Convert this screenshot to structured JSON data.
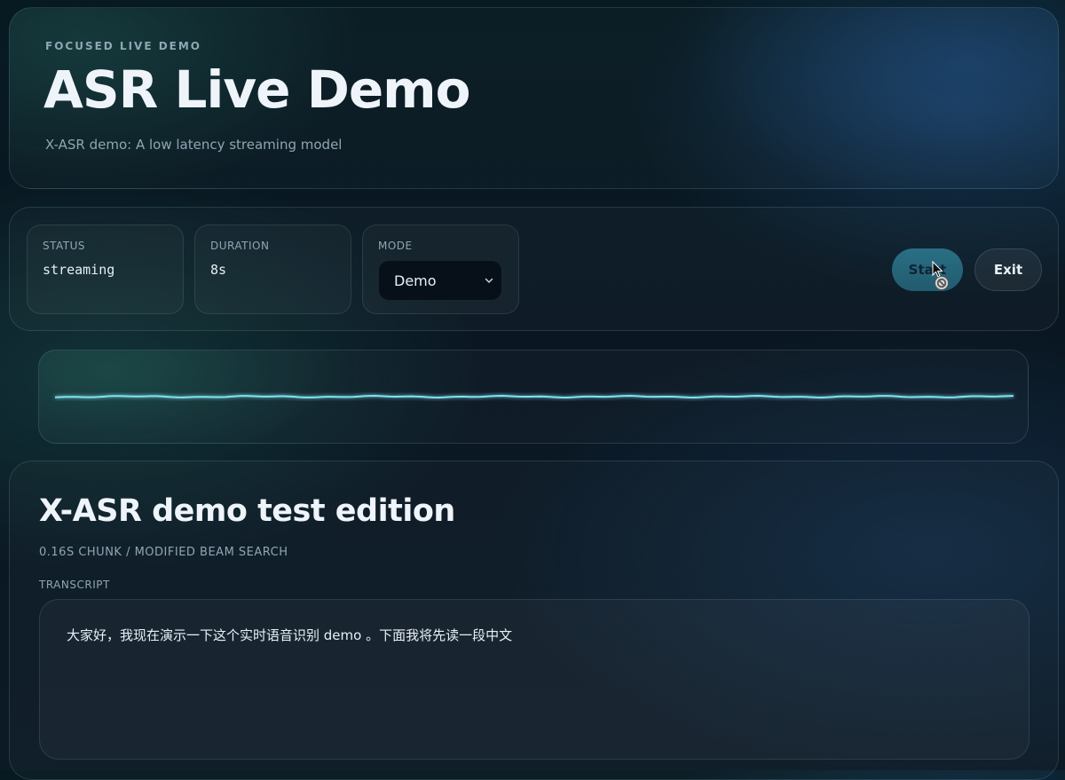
{
  "header": {
    "eyebrow": "FOCUSED LIVE DEMO",
    "title": "ASR Live Demo",
    "subtitle": "X-ASR demo: A low latency streaming model"
  },
  "controls": {
    "status": {
      "label": "STATUS",
      "value": "streaming"
    },
    "duration": {
      "label": "DURATION",
      "value": "8s"
    },
    "mode": {
      "label": "MODE",
      "selected": "Demo"
    },
    "start_label": "Start",
    "exit_label": "Exit"
  },
  "waveform": {
    "color": "#7fe3f0"
  },
  "transcript_panel": {
    "title": "X-ASR demo test edition",
    "meta": "0.16S CHUNK / MODIFIED BEAM SEARCH",
    "label": "TRANSCRIPT",
    "text": "大家好，我现在演示一下这个实时语音识别 demo 。下面我将先读一段中文"
  },
  "icons": {
    "chevron": "chevron-down-icon",
    "cursor": "mouse-pointer-icon",
    "not_allowed": "not-allowed-icon"
  },
  "colors": {
    "accent": "#2f7d94",
    "background": "#0a1722"
  }
}
